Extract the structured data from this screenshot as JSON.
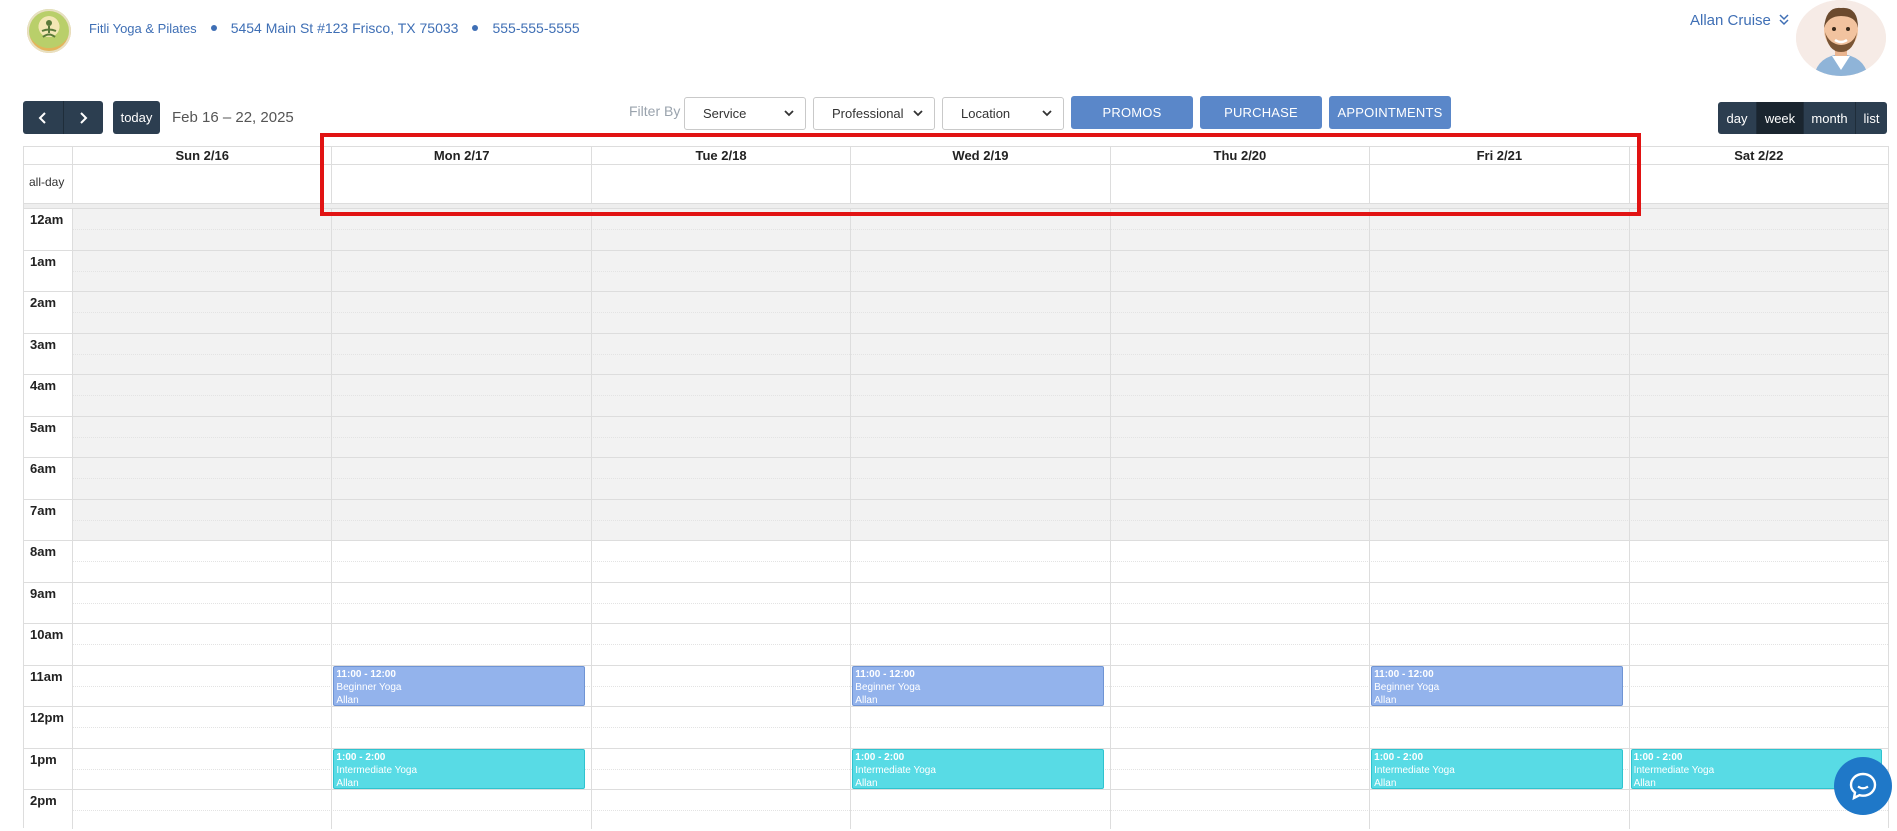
{
  "header": {
    "business_name": "Fitli Yoga & Pilates",
    "address": "5454 Main St #123 Frisco, TX 75033",
    "phone": "555-555-5555",
    "user_name": "Allan Cruise"
  },
  "toolbar": {
    "prev_label": "‹",
    "next_label": "›",
    "today_label": "today",
    "date_range": "Feb 16 – 22, 2025",
    "filter_label": "Filter By",
    "filters": {
      "service": "Service",
      "professional": "Professional",
      "location": "Location"
    },
    "actions": {
      "promos": "PROMOS",
      "purchase": "PURCHASE",
      "appointments": "APPOINTMENTS"
    },
    "views": {
      "day": "day",
      "week": "week",
      "month": "month",
      "list": "list"
    },
    "active_view": "week"
  },
  "calendar": {
    "allday_label": "all-day",
    "days": [
      "Sun 2/16",
      "Mon 2/17",
      "Tue 2/18",
      "Wed 2/19",
      "Thu 2/20",
      "Fri 2/21",
      "Sat 2/22"
    ],
    "hours": [
      "12am",
      "1am",
      "2am",
      "3am",
      "4am",
      "5am",
      "6am",
      "7am",
      "8am",
      "9am",
      "10am",
      "11am",
      "12pm",
      "1pm",
      "2pm"
    ],
    "shaded_hours_until": 8,
    "events": [
      {
        "day": 1,
        "start": 11,
        "end": 12,
        "time": "11:00 - 12:00",
        "title": "Beginner Yoga",
        "instructor": "Allan",
        "kind": "beginner"
      },
      {
        "day": 3,
        "start": 11,
        "end": 12,
        "time": "11:00 - 12:00",
        "title": "Beginner Yoga",
        "instructor": "Allan",
        "kind": "beginner"
      },
      {
        "day": 5,
        "start": 11,
        "end": 12,
        "time": "11:00 - 12:00",
        "title": "Beginner Yoga",
        "instructor": "Allan",
        "kind": "beginner"
      },
      {
        "day": 1,
        "start": 13,
        "end": 14,
        "time": "1:00 - 2:00",
        "title": "Intermediate Yoga",
        "instructor": "Allan",
        "kind": "intermediate"
      },
      {
        "day": 3,
        "start": 13,
        "end": 14,
        "time": "1:00 - 2:00",
        "title": "Intermediate Yoga",
        "instructor": "Allan",
        "kind": "intermediate"
      },
      {
        "day": 5,
        "start": 13,
        "end": 14,
        "time": "1:00 - 2:00",
        "title": "Intermediate Yoga",
        "instructor": "Allan",
        "kind": "intermediate"
      },
      {
        "day": 6,
        "start": 13,
        "end": 14,
        "time": "1:00 - 2:00",
        "title": "Intermediate Yoga",
        "instructor": "Allan",
        "kind": "intermediate"
      }
    ]
  },
  "colors": {
    "brand_blue": "#3f6fb5",
    "dark_button": "#2c3e50",
    "action_button": "#5a87c9",
    "beginner_event": "#93b3ec",
    "intermediate_event": "#58dbe5",
    "highlight_box": "#e11313",
    "chat_bubble": "#1f78c8"
  },
  "icons": {
    "logo": "yoga-meditation-logo-icon",
    "user_chevron": "double-chevron-down-icon",
    "avatar": "bearded-man-avatar-icon",
    "chat": "chat-bubble-icon",
    "select_caret": "chevron-down-icon"
  }
}
